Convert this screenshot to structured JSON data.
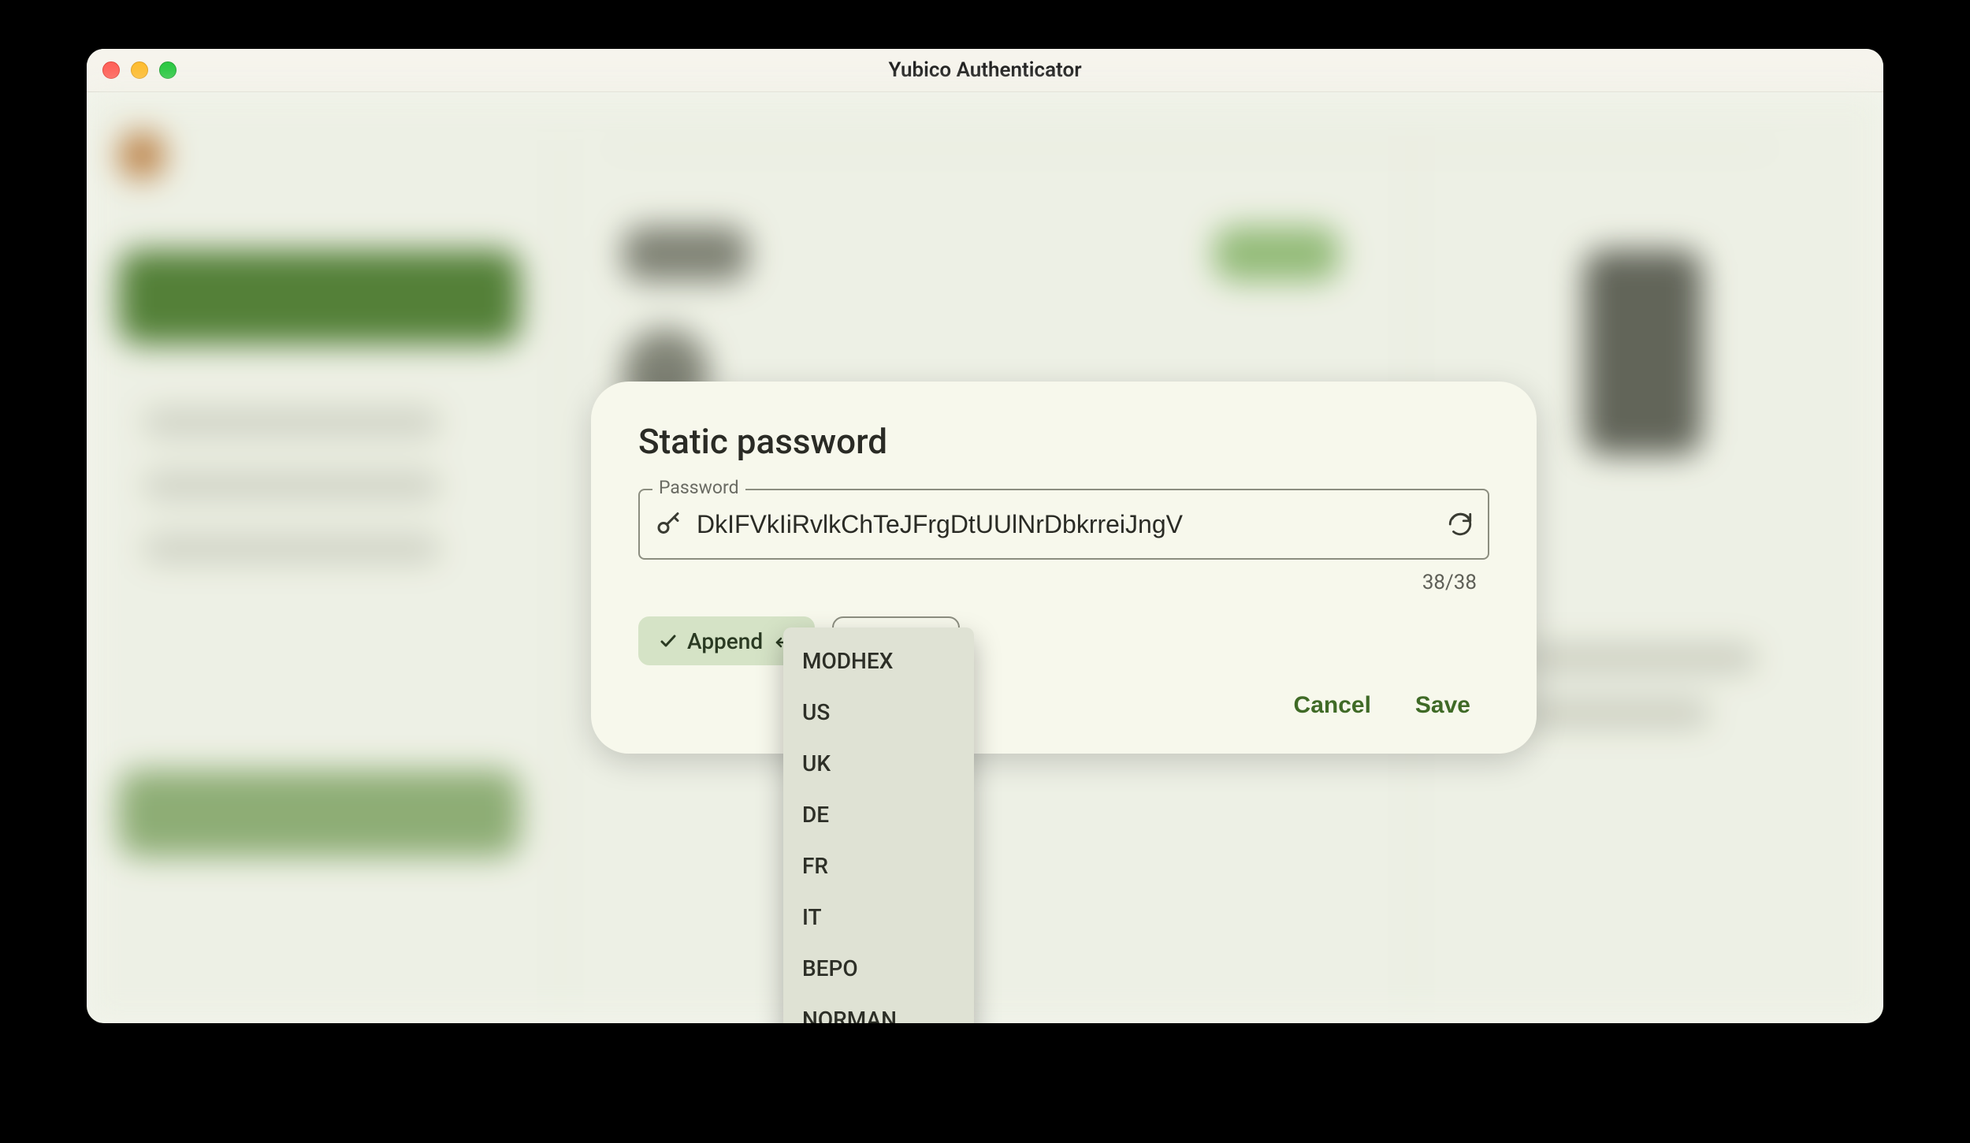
{
  "window": {
    "title": "Yubico Authenticator"
  },
  "dialog": {
    "title": "Static password",
    "password_label": "Password",
    "password_value": "DkIFVkIiRvlkChTeJFrgDtUUlNrDbkrreiJngV",
    "counter": "38/38",
    "append_label": "Append",
    "layout_selected": "MODHEX",
    "layout_visible_suffix": "HEX",
    "cancel_label": "Cancel",
    "save_label": "Save"
  },
  "dropdown": {
    "options": [
      "MODHEX",
      "US",
      "UK",
      "DE",
      "FR",
      "IT",
      "BEPO",
      "NORMAN"
    ]
  },
  "colors": {
    "accent": "#3f6a26",
    "chip_fill": "#d5e3c6",
    "dropdown_bg": "#dfe2d4"
  }
}
